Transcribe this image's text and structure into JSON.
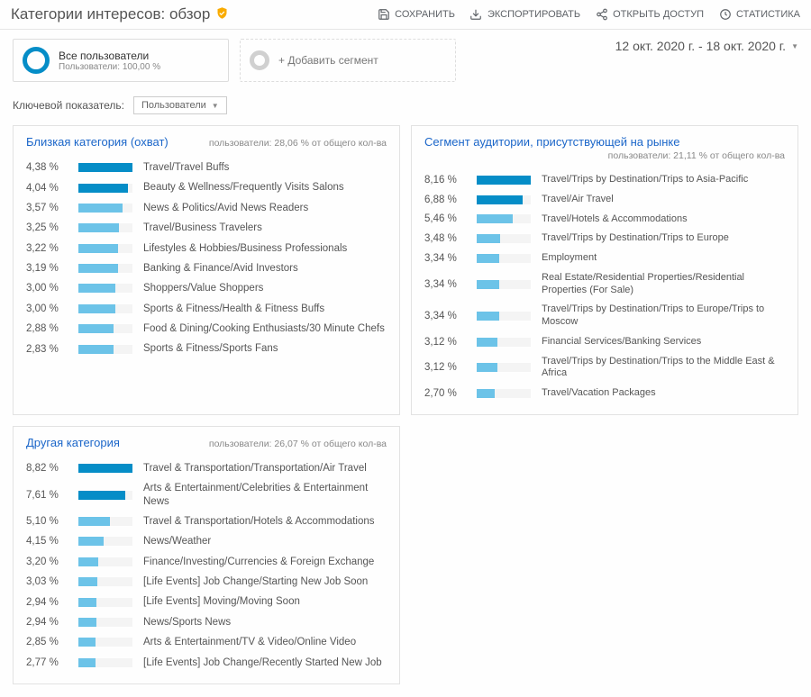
{
  "header": {
    "title": "Категории интересов: обзор",
    "toolbar": {
      "save": "СОХРАНИТЬ",
      "export": "ЭКСПОРТИРОВАТЬ",
      "share": "ОТКРЫТЬ ДОСТУП",
      "stats": "СТАТИСТИКА"
    }
  },
  "segments": {
    "all_users": {
      "title": "Все пользователи",
      "sub": "Пользователи: 100,00 %"
    },
    "add": "+ Добавить сегмент"
  },
  "date_range": "12 окт. 2020 г. - 18 окт. 2020 г.",
  "key_metric": {
    "label": "Ключевой показатель:",
    "value": "Пользователи"
  },
  "panels": {
    "affinity": {
      "title": "Близкая категория (охват)",
      "sub": "пользователи: 28,06 % от общего кол-ва",
      "max": 4.38,
      "rows": [
        {
          "pct": "4,38 %",
          "val": 4.38,
          "label": "Travel/Travel Buffs"
        },
        {
          "pct": "4,04 %",
          "val": 4.04,
          "label": "Beauty & Wellness/Frequently Visits Salons"
        },
        {
          "pct": "3,57 %",
          "val": 3.57,
          "label": "News & Politics/Avid News Readers"
        },
        {
          "pct": "3,25 %",
          "val": 3.25,
          "label": "Travel/Business Travelers"
        },
        {
          "pct": "3,22 %",
          "val": 3.22,
          "label": "Lifestyles & Hobbies/Business Professionals"
        },
        {
          "pct": "3,19 %",
          "val": 3.19,
          "label": "Banking & Finance/Avid Investors"
        },
        {
          "pct": "3,00 %",
          "val": 3.0,
          "label": "Shoppers/Value Shoppers"
        },
        {
          "pct": "3,00 %",
          "val": 3.0,
          "label": "Sports & Fitness/Health & Fitness Buffs"
        },
        {
          "pct": "2,88 %",
          "val": 2.88,
          "label": "Food & Dining/Cooking Enthusiasts/30 Minute Chefs"
        },
        {
          "pct": "2,83 %",
          "val": 2.83,
          "label": "Sports & Fitness/Sports Fans"
        }
      ]
    },
    "inmarket": {
      "title": "Сегмент аудитории, присутствующей на рынке",
      "sub": "пользователи: 21,11 % от общего кол-ва",
      "max": 8.16,
      "rows": [
        {
          "pct": "8,16 %",
          "val": 8.16,
          "label": "Travel/Trips by Destination/Trips to Asia-Pacific"
        },
        {
          "pct": "6,88 %",
          "val": 6.88,
          "label": "Travel/Air Travel"
        },
        {
          "pct": "5,46 %",
          "val": 5.46,
          "label": "Travel/Hotels & Accommodations"
        },
        {
          "pct": "3,48 %",
          "val": 3.48,
          "label": "Travel/Trips by Destination/Trips to Europe"
        },
        {
          "pct": "3,34 %",
          "val": 3.34,
          "label": "Employment"
        },
        {
          "pct": "3,34 %",
          "val": 3.34,
          "label": "Real Estate/Residential Properties/Residential Properties (For Sale)"
        },
        {
          "pct": "3,34 %",
          "val": 3.34,
          "label": "Travel/Trips by Destination/Trips to Europe/Trips to Moscow"
        },
        {
          "pct": "3,12 %",
          "val": 3.12,
          "label": "Financial Services/Banking Services"
        },
        {
          "pct": "3,12 %",
          "val": 3.12,
          "label": "Travel/Trips by Destination/Trips to the Middle East & Africa"
        },
        {
          "pct": "2,70 %",
          "val": 2.7,
          "label": "Travel/Vacation Packages"
        }
      ]
    },
    "other": {
      "title": "Другая категория",
      "sub": "пользователи: 26,07 % от общего кол-ва",
      "max": 8.82,
      "rows": [
        {
          "pct": "8,82 %",
          "val": 8.82,
          "label": "Travel & Transportation/Transportation/Air Travel"
        },
        {
          "pct": "7,61 %",
          "val": 7.61,
          "label": "Arts & Entertainment/Celebrities & Entertainment News"
        },
        {
          "pct": "5,10 %",
          "val": 5.1,
          "label": "Travel & Transportation/Hotels & Accommodations"
        },
        {
          "pct": "4,15 %",
          "val": 4.15,
          "label": "News/Weather"
        },
        {
          "pct": "3,20 %",
          "val": 3.2,
          "label": "Finance/Investing/Currencies & Foreign Exchange"
        },
        {
          "pct": "3,03 %",
          "val": 3.03,
          "label": "[Life Events] Job Change/Starting New Job Soon"
        },
        {
          "pct": "2,94 %",
          "val": 2.94,
          "label": "[Life Events] Moving/Moving Soon"
        },
        {
          "pct": "2,94 %",
          "val": 2.94,
          "label": "News/Sports News"
        },
        {
          "pct": "2,85 %",
          "val": 2.85,
          "label": "Arts & Entertainment/TV & Video/Online Video"
        },
        {
          "pct": "2,77 %",
          "val": 2.77,
          "label": "[Life Events] Job Change/Recently Started New Job"
        }
      ]
    }
  },
  "colors": {
    "bar_dark": "#058dc7",
    "bar_light": "#6cc3e8"
  }
}
